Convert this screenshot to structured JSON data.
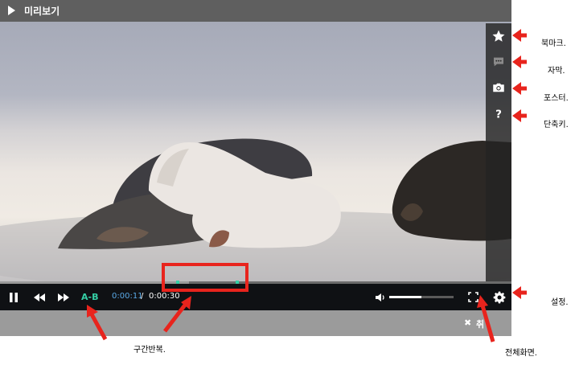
{
  "window": {
    "title": "미리보기"
  },
  "controls": {
    "ab_repeat_label": "A-B",
    "current_time": "0:00:11",
    "time_separator": "/",
    "total_time": "0:00:30",
    "progress": 0.37,
    "volume": 0.5
  },
  "bottom_bar": {
    "close_label": "취"
  },
  "side_toolbar": {
    "icons": [
      "star-icon",
      "chat-icon",
      "camera-icon",
      "help-icon"
    ]
  },
  "annotations": {
    "bookmark": "북마크.",
    "subtitle": "자막.",
    "poster": "포스터.",
    "shortcut": "단축키.",
    "settings": "설정.",
    "ab_repeat": "구간반복.",
    "fullscreen": "전체화면."
  },
  "colors": {
    "accent_ab": "#35d0a6",
    "time_current": "#5aa9e6",
    "annotation_red": "#e8241d"
  }
}
